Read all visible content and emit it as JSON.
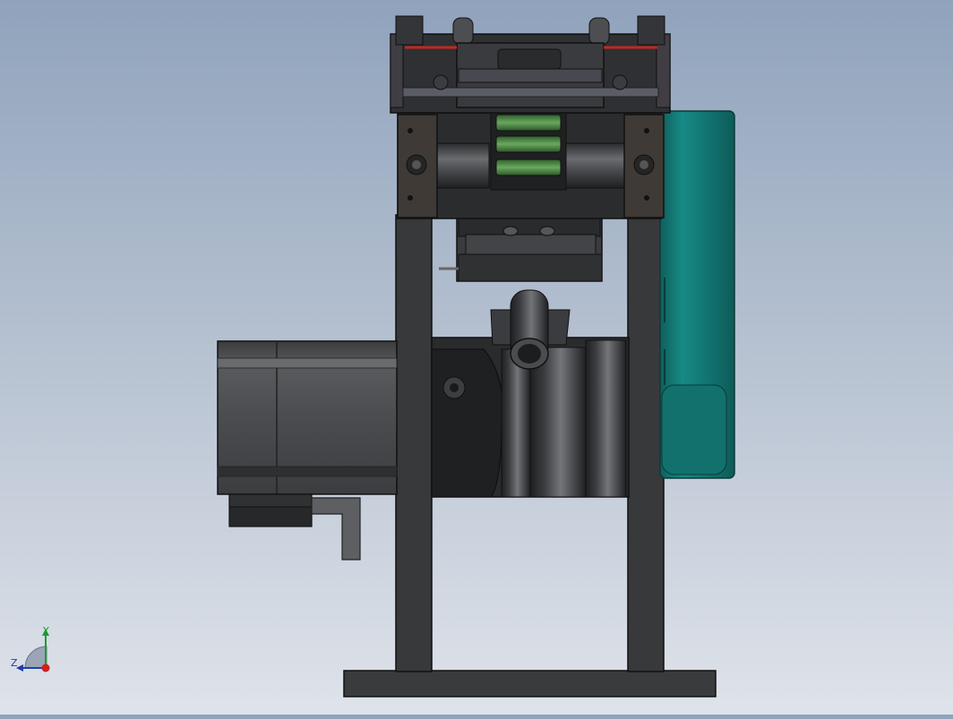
{
  "viewport": {
    "background_top": "#90a3bc",
    "background_bottom": "#dfe3ea"
  },
  "model": {
    "frame_color": "#38393b",
    "motor_color": "#4a4b4d",
    "housing_color": "#147f7a",
    "belt_color": "#c32722",
    "roller_color": "#3f7f3a"
  },
  "triad": {
    "y_label": "Y",
    "z_label": "Z",
    "y_color": "#1f9a35",
    "z_color": "#1f3fae",
    "x_color": "#d0201d"
  }
}
